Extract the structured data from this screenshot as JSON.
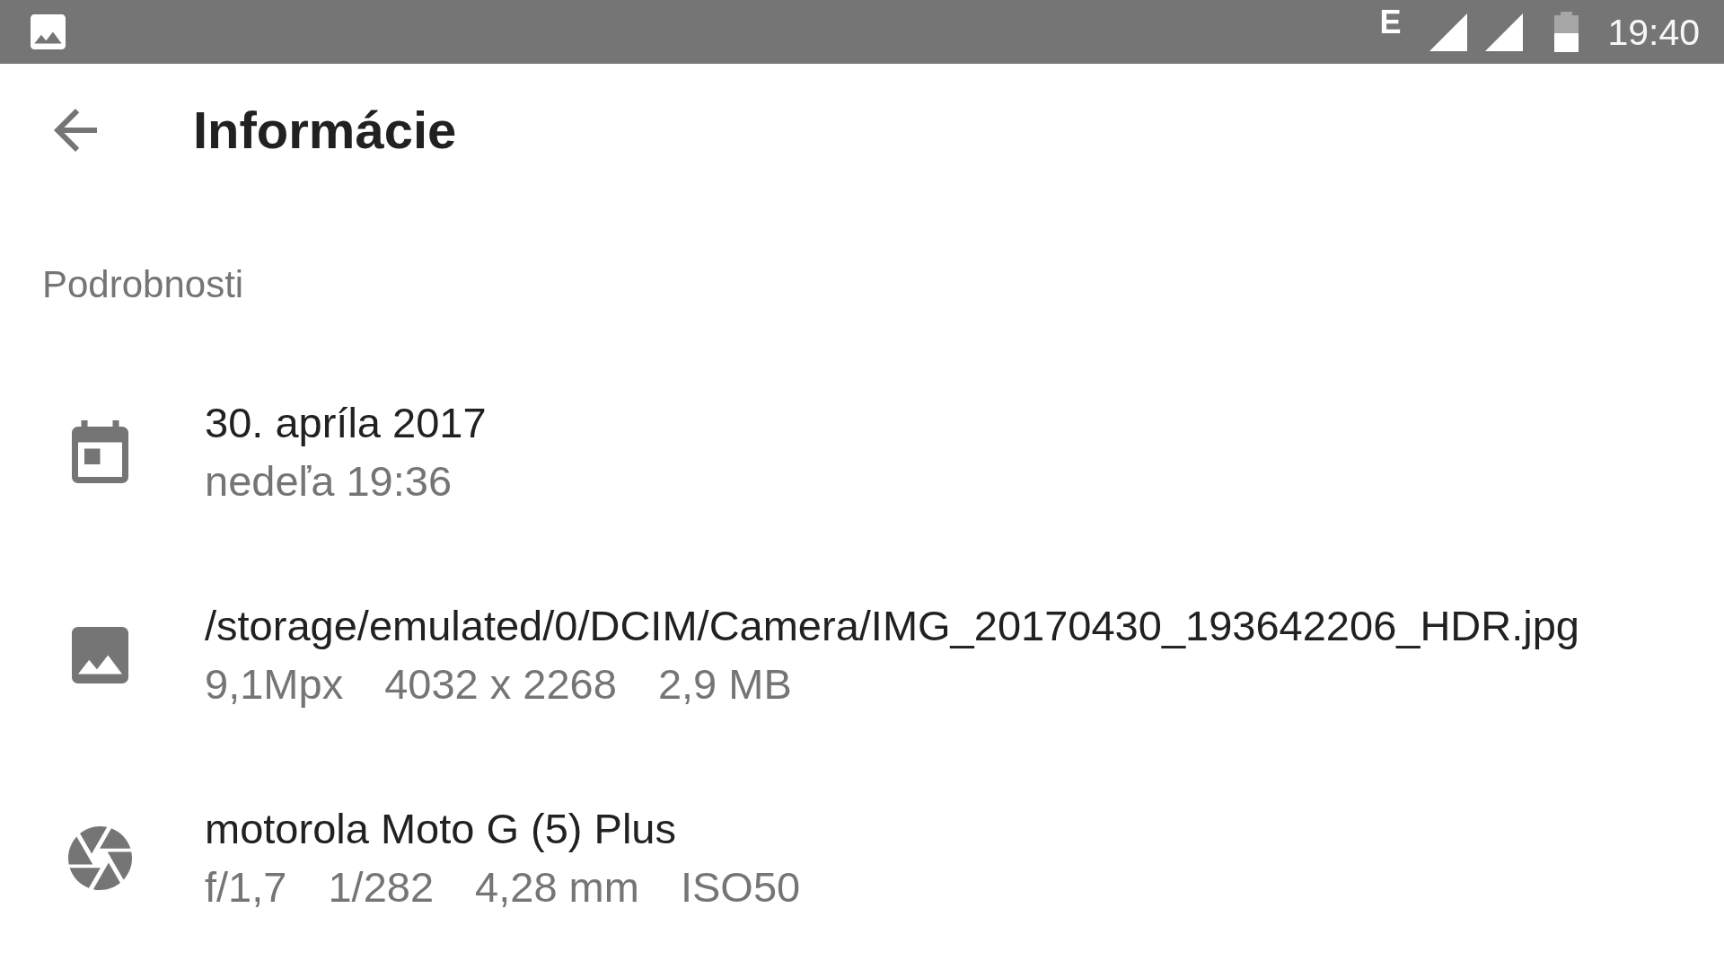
{
  "status_bar": {
    "network_type": "E",
    "time": "19:40"
  },
  "toolbar": {
    "title": "Informácie"
  },
  "section": {
    "title": "Podrobnosti"
  },
  "details": [
    {
      "kind": "date",
      "title": "30. apríla 2017",
      "values": [
        "nedeľa 19:36"
      ]
    },
    {
      "kind": "file",
      "title": "/storage/emulated/0/DCIM/Camera/IMG_20170430_193642206_HDR.jpg",
      "values": [
        "9,1Mpx",
        "4032 x 2268",
        "2,9 MB"
      ]
    },
    {
      "kind": "camera",
      "title": "motorola Moto G (5) Plus",
      "values": [
        "f/1,7",
        "1/282",
        "4,28 mm",
        "ISO50"
      ]
    }
  ]
}
